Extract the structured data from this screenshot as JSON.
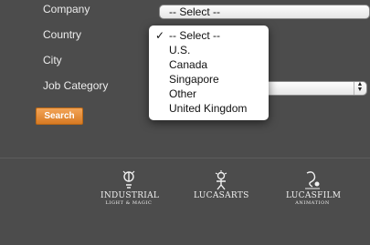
{
  "form": {
    "labels": {
      "company": "Company",
      "country": "Country",
      "city": "City",
      "job_category": "Job Category"
    },
    "company_select_value": "-- Select --",
    "search_label": "Search"
  },
  "dropdown": {
    "checkmark": "✓",
    "items": [
      "-- Select --",
      "U.S.",
      "Canada",
      "Singapore",
      "Other",
      "United Kingdom"
    ]
  },
  "footer": {
    "logos": {
      "industrial": {
        "main": "INDUSTRIAL",
        "sub": "LIGHT & MAGIC",
        "icon": "ilm-logo-icon"
      },
      "lucasarts": {
        "main": "LUCASARTS",
        "icon": "lucasarts-logo-icon"
      },
      "lucasfilm": {
        "main": "LUCASFILM",
        "sub": "ANIMATION",
        "icon": "lucasfilm-logo-icon"
      }
    }
  },
  "colors": {
    "page_bg": "#4c4c4c",
    "label_text": "#ececec",
    "search_button": "#e08a34",
    "dropdown_bg": "#ffffff"
  }
}
